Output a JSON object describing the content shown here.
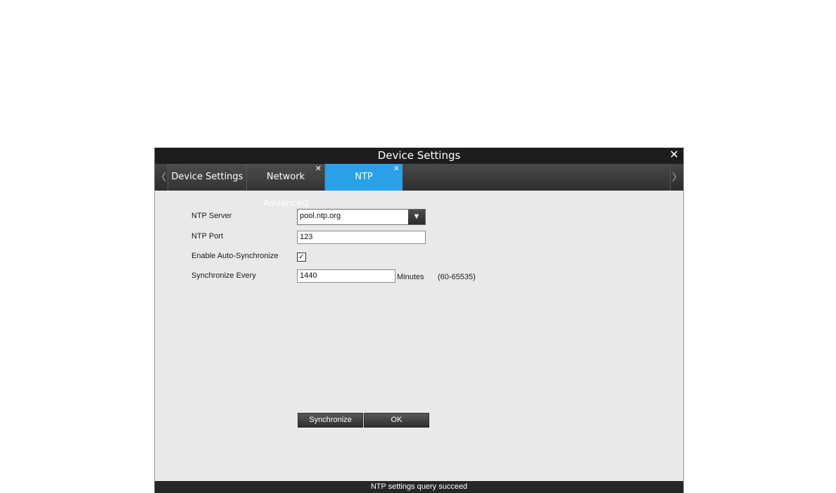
{
  "window": {
    "title": "Device Settings",
    "close_glyph": "✕"
  },
  "tabs": [
    {
      "label": "Device Settings",
      "closable": false,
      "active": false
    },
    {
      "label": "Network Advanced",
      "closable": true,
      "active": false
    },
    {
      "label": "NTP",
      "closable": true,
      "active": true
    }
  ],
  "tab_close_glyph": "✕",
  "scroll": {
    "left_glyph": "〈",
    "right_glyph": "〉"
  },
  "form": {
    "ntp_server": {
      "label": "NTP Server",
      "value": "pool.ntp.org",
      "arrow": "▼"
    },
    "ntp_port": {
      "label": "NTP Port",
      "value": "123"
    },
    "auto_sync": {
      "label": "Enable Auto-Synchronize",
      "checked": true,
      "check_glyph": "✓"
    },
    "sync_every": {
      "label": "Synchronize Every",
      "value": "1440",
      "unit": "Minutes",
      "range": "(60-65535)"
    }
  },
  "buttons": {
    "synchronize": "Synchronize",
    "ok": "OK"
  },
  "status": "NTP settings query succeed",
  "colors": {
    "accent": "#2aa0e8",
    "titlebar": "#1d1d1d",
    "panel": "#e9e9e9"
  }
}
